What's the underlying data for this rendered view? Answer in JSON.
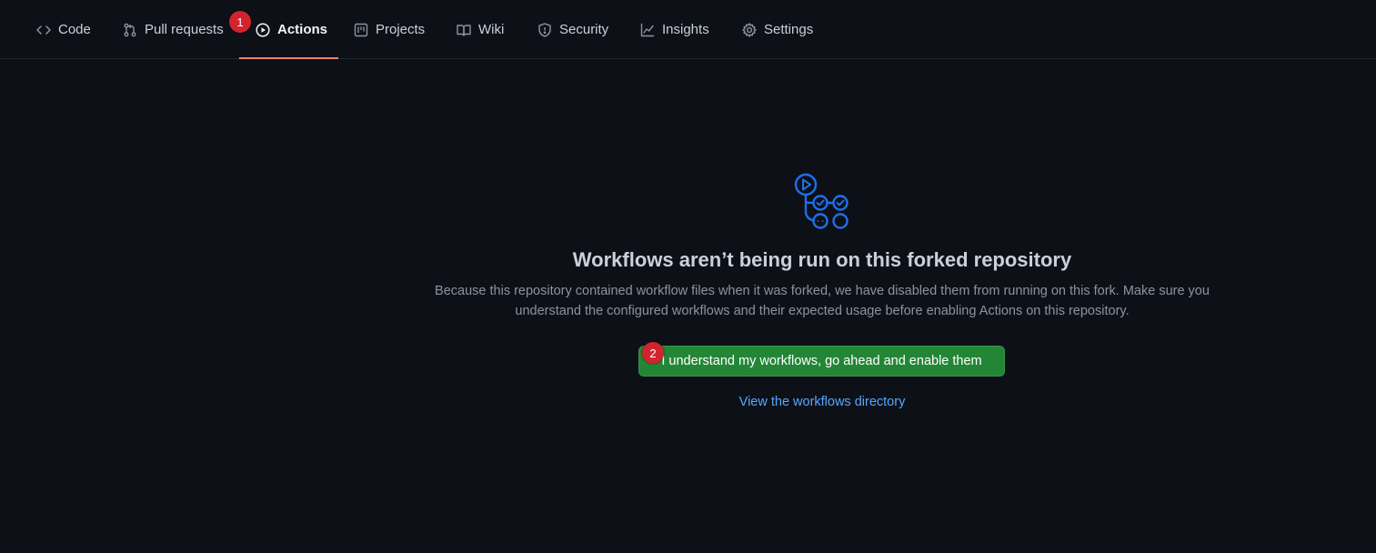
{
  "repo_nav": {
    "tabs": [
      {
        "label": "Code",
        "icon": "code-icon"
      },
      {
        "label": "Pull requests",
        "icon": "pull-request-icon"
      },
      {
        "label": "Actions",
        "icon": "play-icon",
        "active": true
      },
      {
        "label": "Projects",
        "icon": "project-board-icon"
      },
      {
        "label": "Wiki",
        "icon": "book-icon"
      },
      {
        "label": "Security",
        "icon": "shield-icon"
      },
      {
        "label": "Insights",
        "icon": "graph-icon"
      },
      {
        "label": "Settings",
        "icon": "gear-icon"
      }
    ],
    "active_underline_color": "#f78166"
  },
  "annotations": {
    "marker_1": "1",
    "marker_2": "2",
    "marker_color": "#d1242f"
  },
  "empty_state": {
    "icon": "workflow-icon",
    "title": "Workflows aren’t being run on this forked repository",
    "description": "Because this repository contained workflow files when it was forked, we have disabled them from running on this fork. Make sure you understand the configured workflows and their expected usage before enabling Actions on this repository.",
    "enable_button": "I understand my workflows, go ahead and enable them",
    "directory_link": "View the workflows directory"
  },
  "colors": {
    "background": "#0d1117",
    "primary_button": "#238636",
    "link": "#58a6ff"
  }
}
